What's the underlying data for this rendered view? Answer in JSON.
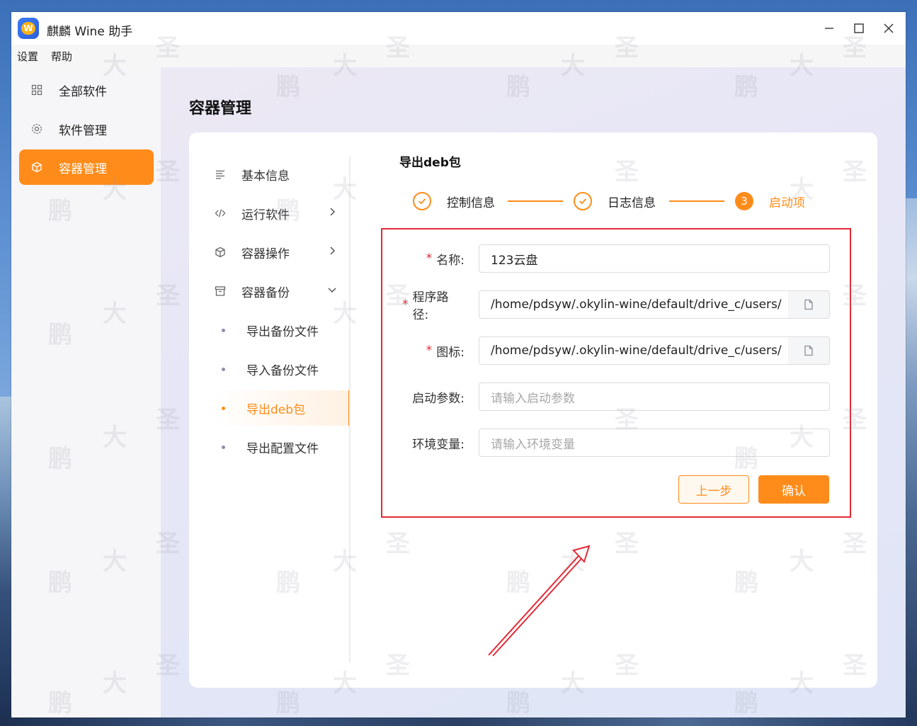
{
  "window": {
    "title": "麒麟 Wine 助手"
  },
  "menu": [
    "设置",
    "帮助"
  ],
  "sidebar": {
    "items": [
      {
        "label": "全部软件",
        "icon": "grid-icon"
      },
      {
        "label": "软件管理",
        "icon": "gear-icon"
      },
      {
        "label": "容器管理",
        "icon": "cube-icon",
        "active": true
      }
    ]
  },
  "page_title": "容器管理",
  "sub_nav": {
    "items": [
      {
        "label": "基本信息",
        "icon": "list-icon"
      },
      {
        "label": "运行软件",
        "icon": "code-icon",
        "chevron": "right"
      },
      {
        "label": "容器操作",
        "icon": "cube-icon",
        "chevron": "right"
      },
      {
        "label": "容器备份",
        "icon": "archive-icon",
        "chevron": "down"
      },
      {
        "label": "导出备份文件"
      },
      {
        "label": "导入备份文件"
      },
      {
        "label": "导出deb包",
        "active": true
      },
      {
        "label": "导出配置文件"
      }
    ]
  },
  "section_title": "导出deb包",
  "steps": [
    {
      "label": "控制信息",
      "state": "done"
    },
    {
      "label": "日志信息",
      "state": "done"
    },
    {
      "label": "启动项",
      "state": "active",
      "number": "3"
    }
  ],
  "form": {
    "name": {
      "label": "名称:",
      "required": true,
      "value": "123云盘"
    },
    "program_path": {
      "label": "程序路径:",
      "required": true,
      "value": "/home/pdsyw/.okylin-wine/default/drive_c/users/"
    },
    "icon": {
      "label": "图标:",
      "required": true,
      "value": "/home/pdsyw/.okylin-wine/default/drive_c/users/"
    },
    "args": {
      "label": "启动参数:",
      "placeholder": "请输入启动参数"
    },
    "env": {
      "label": "环境变量:",
      "placeholder": "请输入环境变量"
    },
    "prev_label": "上一步",
    "confirm_label": "确认"
  },
  "colors": {
    "accent": "#ff8c1a",
    "annotation": "#e32a36"
  }
}
